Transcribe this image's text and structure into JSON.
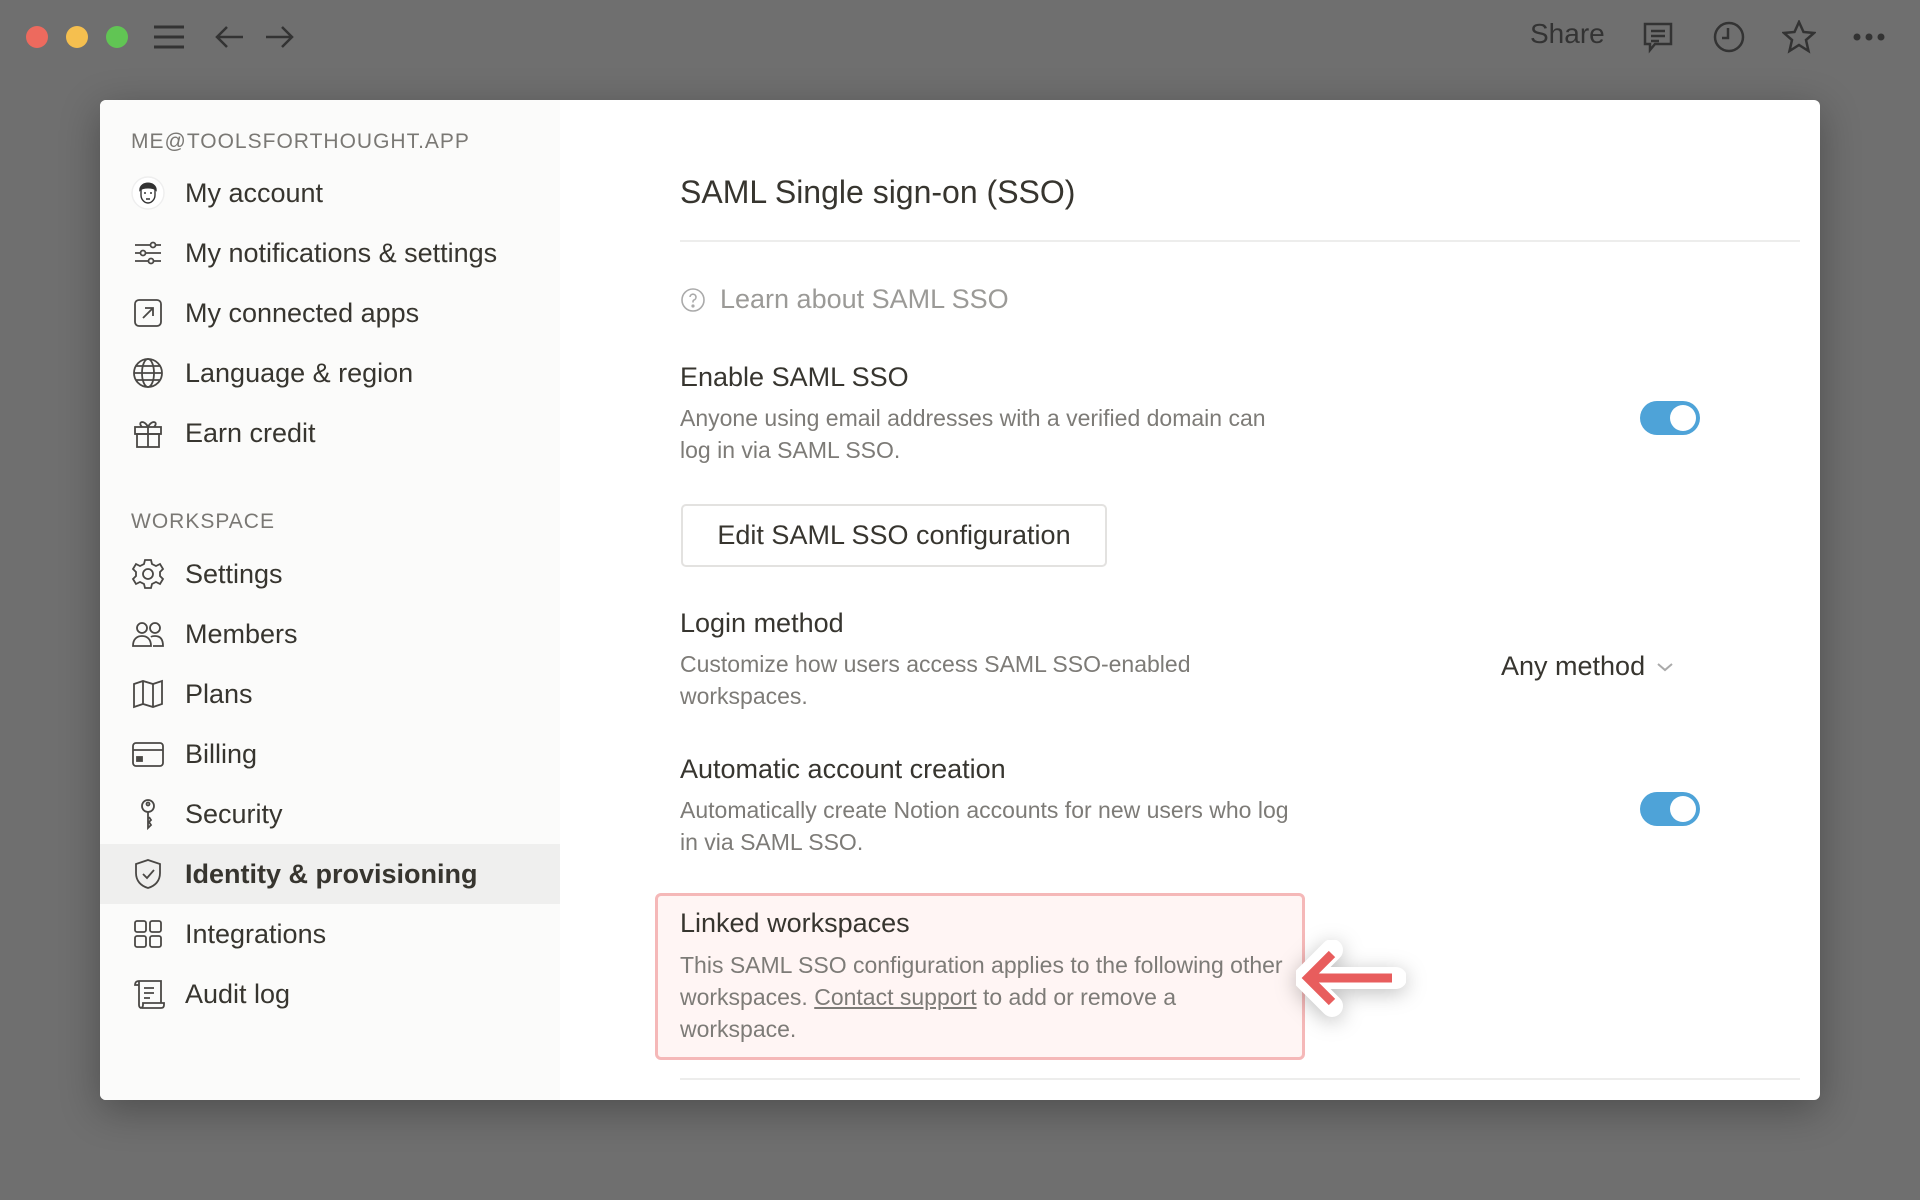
{
  "titlebar": {
    "share": "Share",
    "icons": [
      "close",
      "minimize",
      "maximize",
      "menu-icon",
      "back-arrow-icon",
      "forward-arrow-icon",
      "comment-icon",
      "clock-icon",
      "star-icon",
      "more-icon"
    ]
  },
  "sidebar": {
    "account_label": "ME@TOOLSFORTHOUGHT.APP",
    "account_items": [
      {
        "label": "My account",
        "icon": "avatar"
      },
      {
        "label": "My notifications & settings",
        "icon": "sliders-icon"
      },
      {
        "label": "My connected apps",
        "icon": "external-link-icon"
      },
      {
        "label": "Language & region",
        "icon": "globe-icon"
      },
      {
        "label": "Earn credit",
        "icon": "gift-icon"
      }
    ],
    "workspace_label": "WORKSPACE",
    "workspace_items": [
      {
        "label": "Settings",
        "icon": "gear-icon"
      },
      {
        "label": "Members",
        "icon": "members-icon"
      },
      {
        "label": "Plans",
        "icon": "map-icon"
      },
      {
        "label": "Billing",
        "icon": "credit-card-icon"
      },
      {
        "label": "Security",
        "icon": "key-icon"
      },
      {
        "label": "Identity & provisioning",
        "icon": "shield-check-icon",
        "active": true
      },
      {
        "label": "Integrations",
        "icon": "grid-icon"
      },
      {
        "label": "Audit log",
        "icon": "scroll-icon"
      }
    ]
  },
  "main": {
    "title": "SAML Single sign-on (SSO)",
    "learn_link": "Learn about SAML SSO",
    "enable": {
      "title": "Enable SAML SSO",
      "desc": "Anyone using email addresses with a verified domain can log in via SAML SSO.",
      "on": true
    },
    "edit_button": "Edit SAML SSO configuration",
    "login": {
      "title": "Login method",
      "desc": "Customize how users access SAML SSO-enabled workspaces.",
      "value": "Any method"
    },
    "auto": {
      "title": "Automatic account creation",
      "desc": "Automatically create Notion accounts for new users who log in via SAML SSO.",
      "on": true
    },
    "linked": {
      "title": "Linked workspaces",
      "desc_before": "This SAML SSO configuration applies to the following other workspaces. ",
      "link": "Contact support",
      "desc_after": " to add or remove a workspace."
    }
  },
  "colors": {
    "toggle": "#4ea3d8",
    "highlight_border": "#f5b8b8",
    "arrow": "#e85d5d"
  }
}
